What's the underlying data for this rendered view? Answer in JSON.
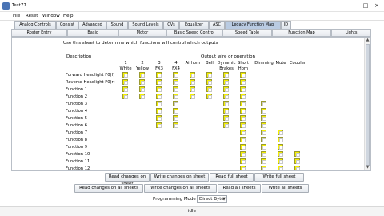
{
  "window": {
    "title": "Test77"
  },
  "menu": [
    "File",
    "Reset",
    "Window",
    "Help"
  ],
  "tabs_top": [
    {
      "label": "Analog Controls",
      "active": false
    },
    {
      "label": "Consist",
      "active": false
    },
    {
      "label": "Advanced",
      "active": false
    },
    {
      "label": "Sound",
      "active": false
    },
    {
      "label": "Sound Levels",
      "active": false
    },
    {
      "label": "CVs",
      "active": false
    },
    {
      "label": "Equalizer",
      "active": false
    },
    {
      "label": "ASC",
      "active": false
    },
    {
      "label": "Legacy Function Map",
      "active": true
    },
    {
      "label": "ID",
      "active": false
    }
  ],
  "tabs_second": [
    "Roster Entry",
    "Basic",
    "Motor",
    "Basic Speed Control",
    "Speed Table",
    "Function Map",
    "Lights"
  ],
  "panel": {
    "instructions": "Use this sheet to determine which functions will control which outputs",
    "description_header": "Description",
    "output_header": "Output wire or operation",
    "columns": [
      {
        "id": "c1",
        "line1": "1",
        "line2": "White"
      },
      {
        "id": "c2",
        "line1": "2",
        "line2": "Yellow"
      },
      {
        "id": "c3",
        "line1": "3",
        "line2": "FX3"
      },
      {
        "id": "c4",
        "line1": "4",
        "line2": "FX4"
      },
      {
        "id": "c5",
        "line1": "",
        "line2": "Airhorn"
      },
      {
        "id": "c6",
        "line1": "",
        "line2": "Bell"
      },
      {
        "id": "c7",
        "line1": "Dynamic",
        "line2": "Brakes"
      },
      {
        "id": "c8",
        "line1": "Short",
        "line2": "Horn"
      },
      {
        "id": "c9",
        "line1": "",
        "line2": "Dimming"
      },
      {
        "id": "c10",
        "line1": "",
        "line2": "Mute"
      },
      {
        "id": "c11",
        "line1": "",
        "line2": "Coupler"
      }
    ],
    "rows": [
      {
        "label": "Forward Headlight F0(f)",
        "boxes": [
          1,
          1,
          1,
          1,
          1,
          1,
          1,
          1,
          0,
          0,
          0
        ]
      },
      {
        "label": "Reverse Headlight F0(r)",
        "boxes": [
          1,
          1,
          1,
          1,
          1,
          1,
          1,
          1,
          0,
          0,
          0
        ]
      },
      {
        "label": "Function 1",
        "boxes": [
          1,
          1,
          1,
          1,
          1,
          1,
          1,
          1,
          0,
          0,
          0
        ]
      },
      {
        "label": "Function 2",
        "boxes": [
          1,
          1,
          1,
          1,
          1,
          1,
          1,
          1,
          0,
          0,
          0
        ]
      },
      {
        "label": "Function 3",
        "boxes": [
          0,
          0,
          1,
          1,
          0,
          0,
          1,
          1,
          1,
          0,
          0
        ]
      },
      {
        "label": "Function 4",
        "boxes": [
          0,
          0,
          1,
          1,
          0,
          0,
          1,
          1,
          1,
          0,
          0
        ]
      },
      {
        "label": "Function 5",
        "boxes": [
          0,
          0,
          1,
          1,
          0,
          0,
          1,
          1,
          1,
          0,
          0
        ]
      },
      {
        "label": "Function 6",
        "boxes": [
          0,
          0,
          1,
          1,
          0,
          0,
          1,
          1,
          1,
          0,
          0
        ]
      },
      {
        "label": "Function 7",
        "boxes": [
          0,
          0,
          0,
          0,
          0,
          0,
          0,
          1,
          1,
          1,
          0
        ]
      },
      {
        "label": "Function 8",
        "boxes": [
          0,
          0,
          0,
          0,
          0,
          0,
          0,
          1,
          1,
          1,
          0
        ]
      },
      {
        "label": "Function 9",
        "boxes": [
          0,
          0,
          0,
          0,
          0,
          0,
          0,
          1,
          1,
          1,
          0
        ]
      },
      {
        "label": "Function 10",
        "boxes": [
          0,
          0,
          0,
          0,
          0,
          0,
          0,
          1,
          1,
          1,
          1
        ]
      },
      {
        "label": "Function 11",
        "boxes": [
          0,
          0,
          0,
          0,
          0,
          0,
          0,
          1,
          1,
          1,
          1
        ]
      },
      {
        "label": "Function 12",
        "boxes": [
          0,
          0,
          0,
          0,
          0,
          0,
          0,
          1,
          1,
          1,
          1
        ]
      }
    ]
  },
  "buttons_sheet": {
    "read_sheet": "Read changes on sheet",
    "write_sheet": "Write changes on sheet",
    "read_full": "Read full sheet",
    "write_full": "Write full sheet"
  },
  "buttons_all": {
    "read_changes_all": "Read changes on all sheets",
    "write_changes_all": "Write changes on all sheets",
    "read_all": "Read all sheets",
    "write_all": "Write all sheets"
  },
  "programming": {
    "label": "Programming Mode",
    "value": "Direct Byte"
  },
  "status": {
    "text": "idle"
  },
  "colors": {
    "checkbox": "#f5f000",
    "active_tab": "#b9cbe2"
  }
}
